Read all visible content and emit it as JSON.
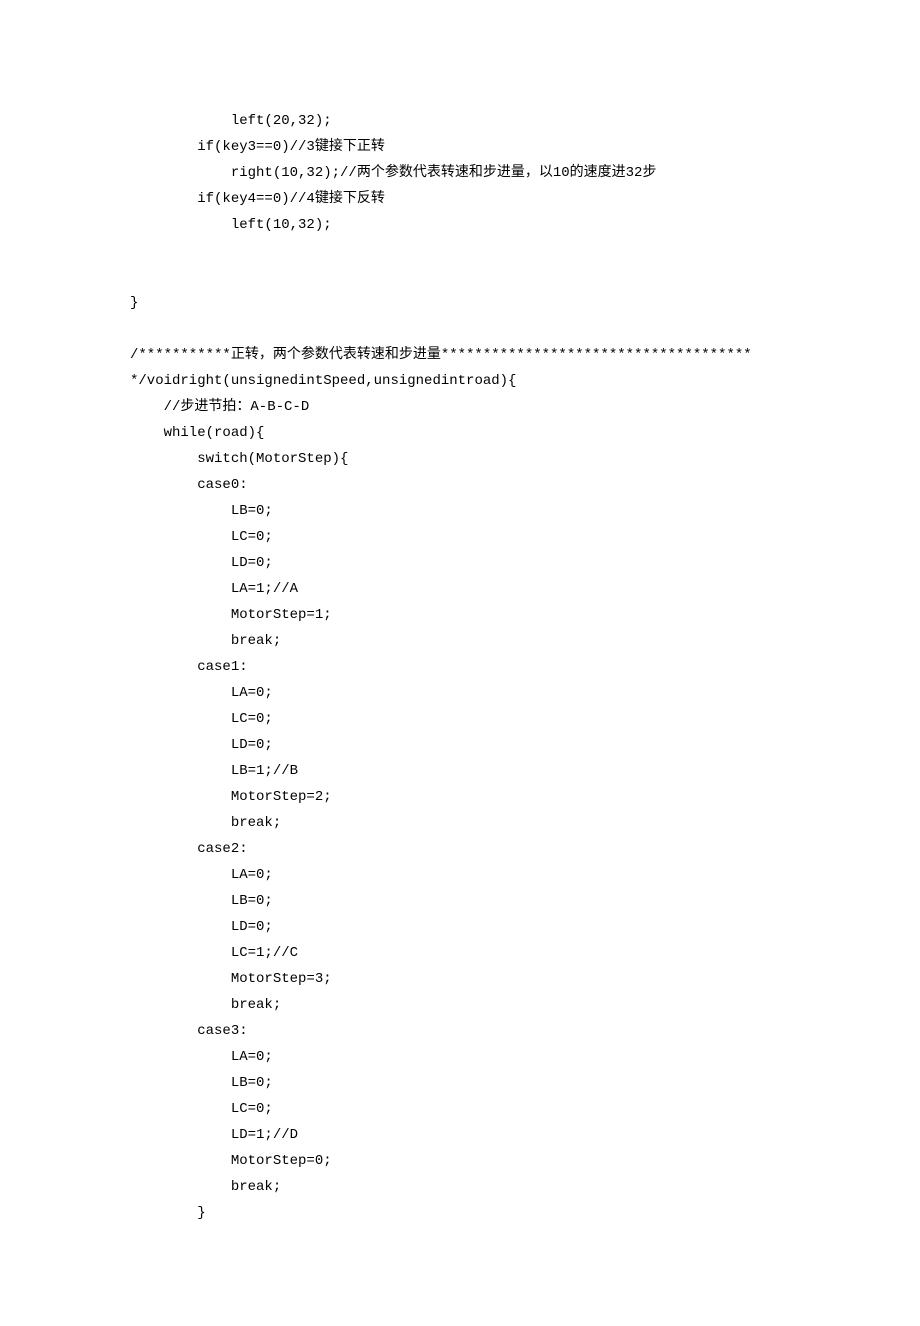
{
  "lines": [
    "            left(20,32);",
    "        if(key3==0)//3键接下正转",
    "            right(10,32);//两个参数代表转速和步进量，以10的速度进32步",
    "        if(key4==0)//4键接下反转",
    "            left(10,32);",
    "",
    "",
    "}",
    "",
    "/***********正转，两个参数代表转速和步进量*************************************",
    "*/voidright(unsignedintSpeed,unsignedintroad){",
    "    //步进节拍：A-B-C-D",
    "    while(road){",
    "        switch(MotorStep){",
    "        case0:",
    "            LB=0;",
    "            LC=0;",
    "            LD=0;",
    "            LA=1;//A",
    "            MotorStep=1;",
    "            break;",
    "        case1:",
    "            LA=0;",
    "            LC=0;",
    "            LD=0;",
    "            LB=1;//B",
    "            MotorStep=2;",
    "            break;",
    "        case2:",
    "            LA=0;",
    "            LB=0;",
    "            LD=0;",
    "            LC=1;//C",
    "            MotorStep=3;",
    "            break;",
    "        case3:",
    "            LA=0;",
    "            LB=0;",
    "            LC=0;",
    "            LD=1;//D",
    "            MotorStep=0;",
    "            break;",
    "        }"
  ]
}
